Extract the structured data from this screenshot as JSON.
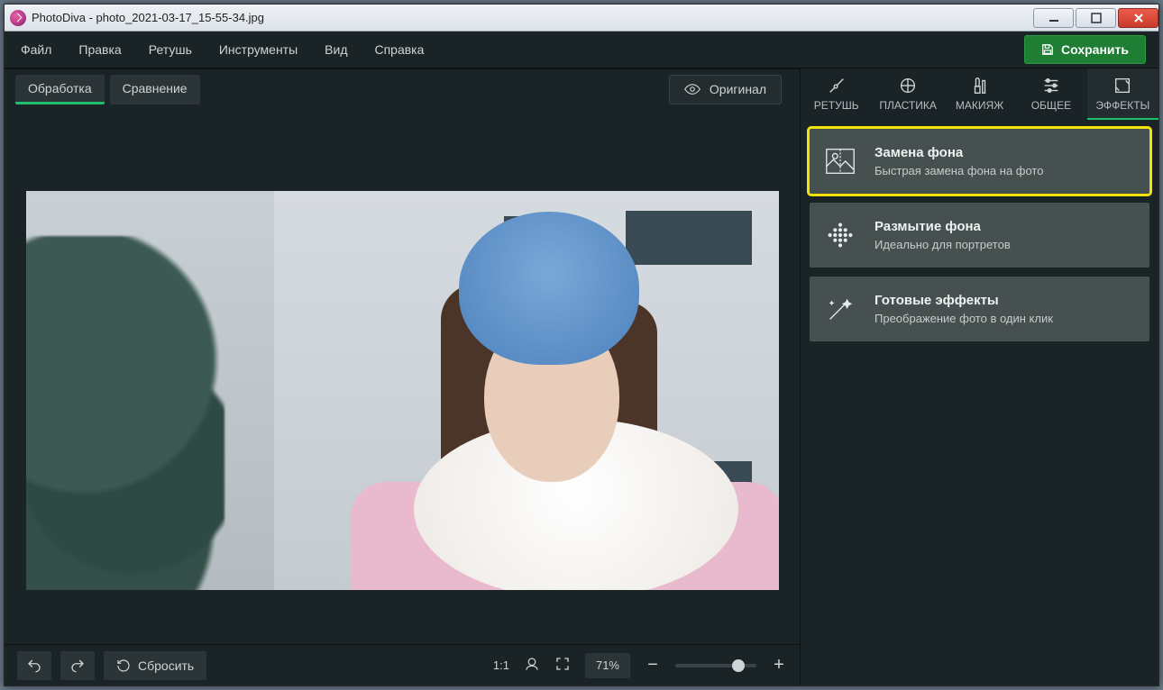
{
  "window": {
    "title": "PhotoDiva - photo_2021-03-17_15-55-34.jpg"
  },
  "menubar": {
    "items": [
      "Файл",
      "Правка",
      "Ретушь",
      "Инструменты",
      "Вид",
      "Справка"
    ],
    "save_label": "Сохранить"
  },
  "toolbar": {
    "tabs": {
      "edit": "Обработка",
      "compare": "Сравнение"
    },
    "active_tab": "edit",
    "original_label": "Оригинал"
  },
  "side_tabs": {
    "items": [
      {
        "id": "retouch",
        "label": "РЕТУШЬ"
      },
      {
        "id": "plastika",
        "label": "ПЛАСТИКА"
      },
      {
        "id": "makeup",
        "label": "МАКИЯЖ"
      },
      {
        "id": "general",
        "label": "ОБЩЕЕ"
      },
      {
        "id": "effects",
        "label": "ЭФФЕКТЫ"
      }
    ],
    "active_id": "effects"
  },
  "effects": [
    {
      "id": "replace-bg",
      "title": "Замена фона",
      "subtitle": "Быстрая замена фона на фото",
      "highlight": true
    },
    {
      "id": "blur-bg",
      "title": "Размытие фона",
      "subtitle": "Идеально для портретов",
      "highlight": false
    },
    {
      "id": "presets",
      "title": "Готовые эффекты",
      "subtitle": "Преображение фото в один клик",
      "highlight": false
    }
  ],
  "bottombar": {
    "reset_label": "Сбросить",
    "ratio_label": "1:1",
    "zoom_value": "71%"
  },
  "colors": {
    "accent": "#1fbf6b",
    "highlight": "#f2e20a",
    "save_btn": "#1e7e34"
  }
}
